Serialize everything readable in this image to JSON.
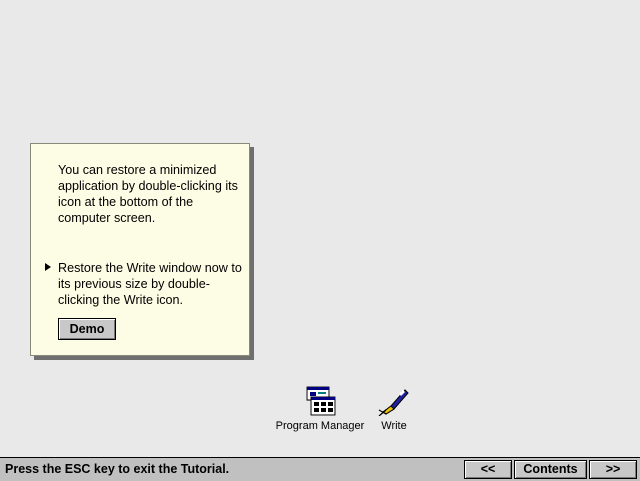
{
  "tip": {
    "paragraph": "You can restore a minimized application by double-clicking its icon at the bottom of the computer screen.",
    "step": "Restore the Write window now to its previous size by double-clicking the Write icon.",
    "demo_label": "Demo"
  },
  "desktop_icons": {
    "program_manager": {
      "label": "Program Manager",
      "icon": "program-manager-icon"
    },
    "write": {
      "label": "Write",
      "icon": "write-pen-icon"
    }
  },
  "statusbar": {
    "message": "Press the ESC key to exit the Tutorial.",
    "prev_label": "<<",
    "contents_label": "Contents",
    "next_label": ">>"
  },
  "colors": {
    "tip_background": "#fdfde6",
    "statusbar_background": "#c0c0c0",
    "desktop_pattern": "#a8a8a8"
  }
}
